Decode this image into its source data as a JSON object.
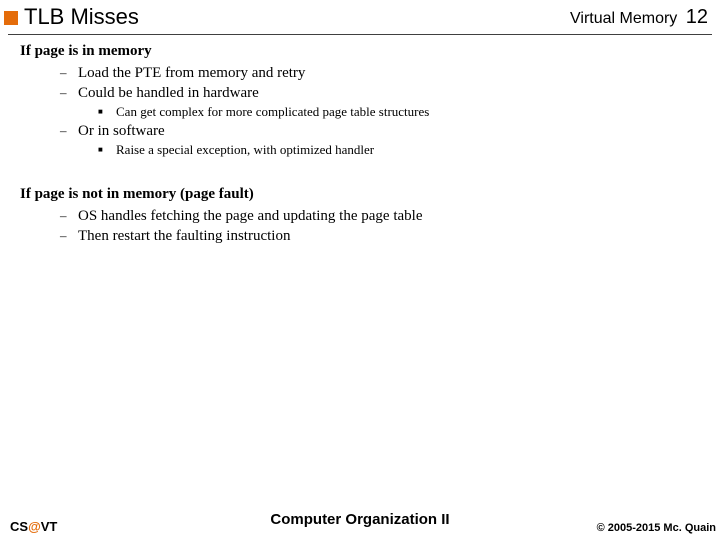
{
  "header": {
    "title": "TLB Misses",
    "topic": "Virtual Memory",
    "page": "12"
  },
  "section1": {
    "heading": "If page is in memory",
    "items": [
      {
        "level": 1,
        "text": "Load the PTE from memory and retry"
      },
      {
        "level": 1,
        "text": "Could be handled in hardware"
      },
      {
        "level": 2,
        "text": "Can get complex for more complicated page table structures"
      },
      {
        "level": 1,
        "text": "Or in software"
      },
      {
        "level": 2,
        "text": "Raise a special exception, with optimized handler"
      }
    ]
  },
  "section2": {
    "heading_prefix": "If page is ",
    "heading_em": "not",
    "heading_suffix": " in memory (page fault)",
    "items": [
      {
        "level": 1,
        "text": "OS handles fetching the page and updating the page table"
      },
      {
        "level": 1,
        "text": "Then restart the faulting instruction"
      }
    ]
  },
  "footer": {
    "left_cs": "CS",
    "left_at": "@",
    "left_vt": "VT",
    "center": "Computer Organization II",
    "right": "© 2005-2015 Mc. Quain"
  }
}
